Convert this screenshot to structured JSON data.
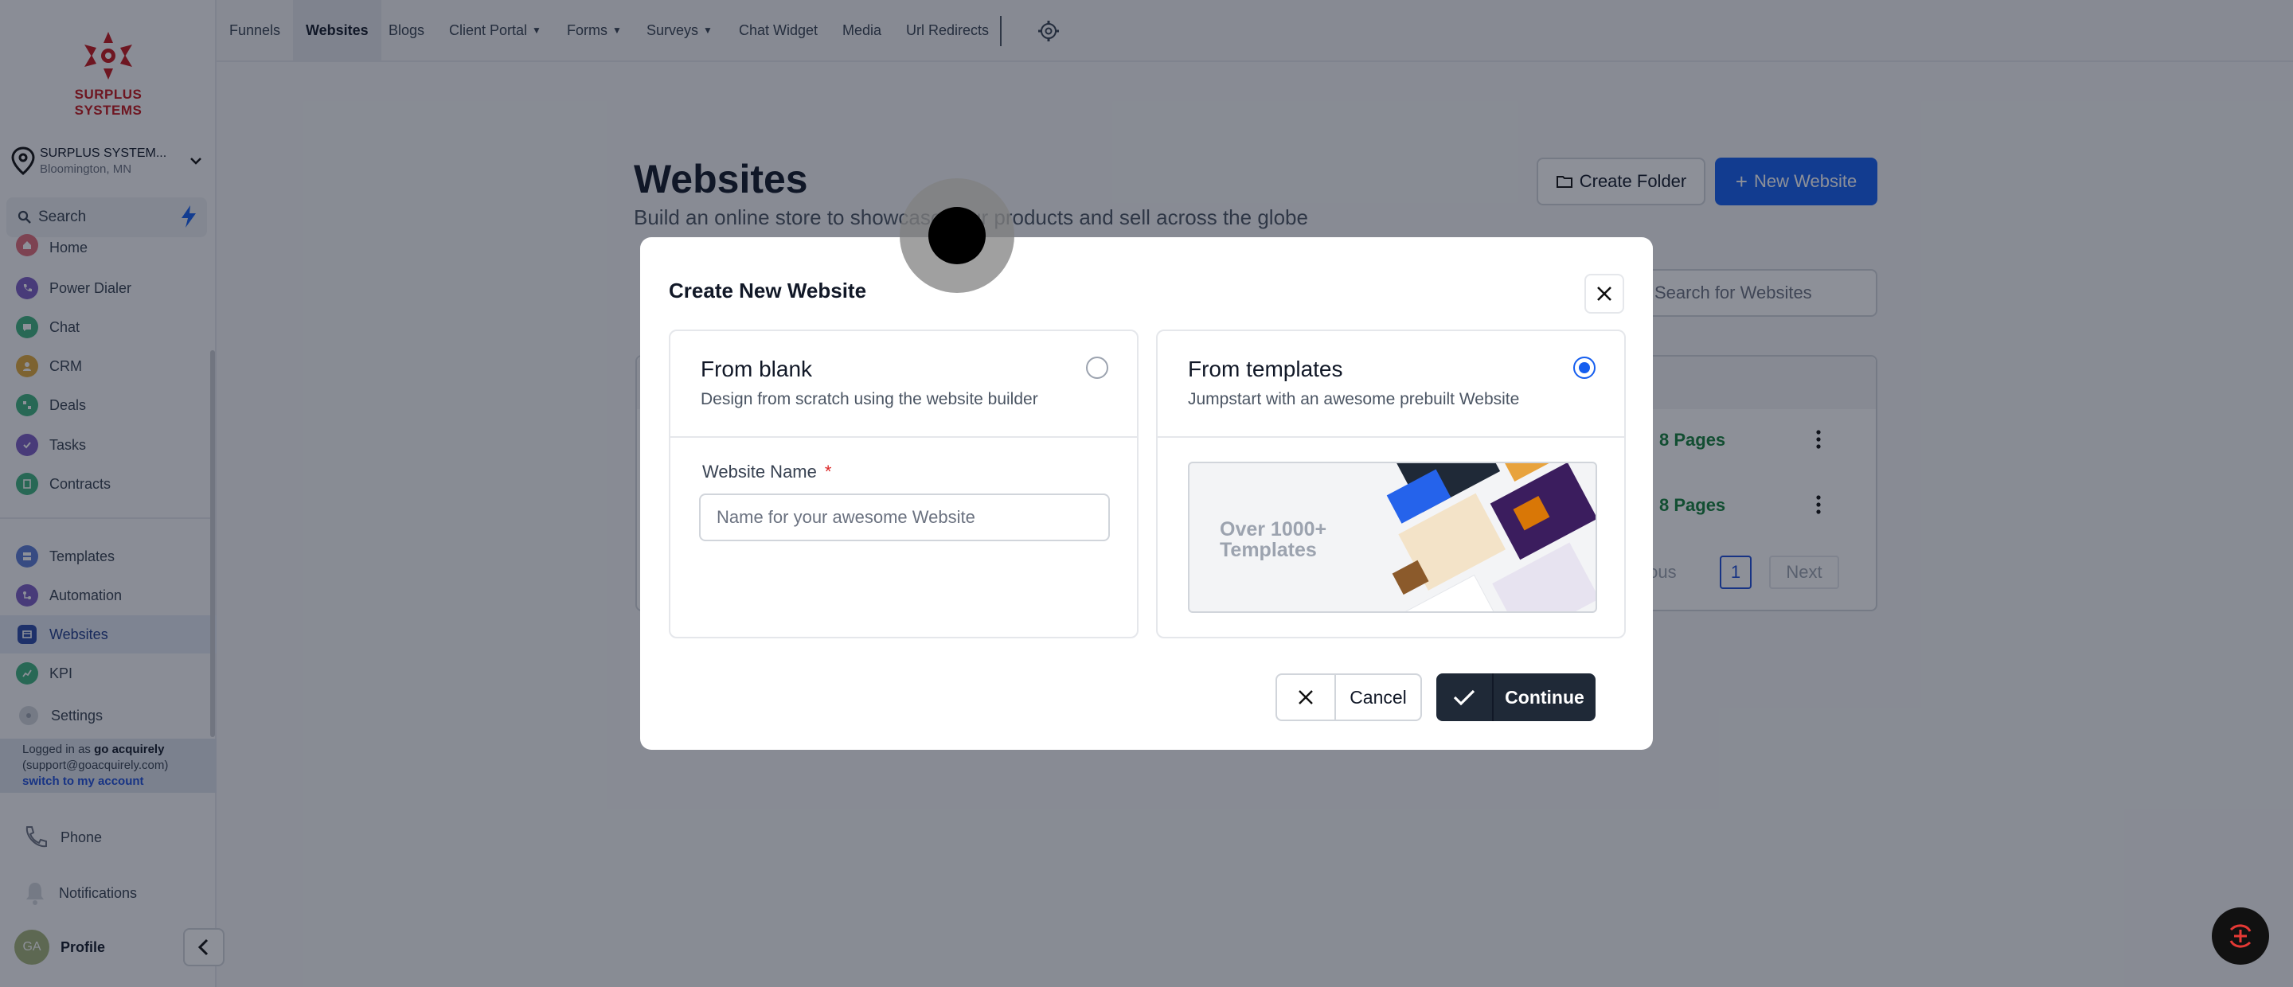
{
  "brand": {
    "name": "SURPLUS SYSTEMS"
  },
  "location": {
    "name": "SURPLUS SYSTEM...",
    "city": "Bloomington, MN"
  },
  "search": {
    "placeholder": "Search"
  },
  "sidebar": {
    "items": [
      {
        "label": "Home",
        "icon": "home-icon",
        "color": "#e06b7a"
      },
      {
        "label": "Power Dialer",
        "icon": "phone-dialer-icon",
        "color": "#7c5cc4"
      },
      {
        "label": "Chat",
        "icon": "chat-icon",
        "color": "#3fb27f"
      },
      {
        "label": "CRM",
        "icon": "crm-icon",
        "color": "#e0a93b"
      },
      {
        "label": "Deals",
        "icon": "deals-icon",
        "color": "#3fb27f"
      },
      {
        "label": "Tasks",
        "icon": "tasks-icon",
        "color": "#7c5cc4"
      },
      {
        "label": "Contracts",
        "icon": "contracts-icon",
        "color": "#3fb27f"
      },
      {
        "label": "Templates",
        "icon": "templates-icon",
        "color": "#5b7bd5"
      },
      {
        "label": "Automation",
        "icon": "automation-icon",
        "color": "#7c5cc4"
      },
      {
        "label": "Websites",
        "icon": "websites-icon",
        "color": "#2b4aa8"
      },
      {
        "label": "KPI",
        "icon": "kpi-icon",
        "color": "#3fb27f"
      },
      {
        "label": "Settings",
        "icon": "settings-icon",
        "color": "#9ca3af"
      }
    ]
  },
  "login": {
    "prefix": "Logged in as ",
    "user": "go acquirely",
    "email": "(support@goacquirely.com)",
    "switch": "switch to my account"
  },
  "bottom": {
    "phone": "Phone",
    "notifications": "Notifications",
    "profile": "Profile",
    "initials": "GA"
  },
  "topbar": {
    "tabs": [
      {
        "label": "Funnels"
      },
      {
        "label": "Websites"
      },
      {
        "label": "Blogs"
      },
      {
        "label": "Client Portal"
      },
      {
        "label": "Forms"
      },
      {
        "label": "Surveys"
      },
      {
        "label": "Chat Widget"
      },
      {
        "label": "Media"
      },
      {
        "label": "Url Redirects"
      }
    ]
  },
  "page": {
    "title": "Websites",
    "subtitle": "Build an online store to showcase your products and sell across the globe",
    "create_folder": "Create Folder",
    "new_website": "New Website",
    "search_placeholder": "Search for Websites",
    "rows": [
      {
        "pages": "8 Pages"
      },
      {
        "pages": "8 Pages"
      }
    ],
    "pagination": {
      "previous": "Previous",
      "current": "1",
      "next": "Next"
    }
  },
  "modal": {
    "title": "Create New Website",
    "blank": {
      "title": "From blank",
      "desc": "Design from scratch using the website builder",
      "selected": false
    },
    "templates": {
      "title": "From templates",
      "desc": "Jumpstart with an awesome prebuilt Website",
      "selected": true,
      "image_text": "Over 1000+ Templates"
    },
    "field": {
      "label": "Website Name",
      "required": "*",
      "placeholder": "Name for your awesome Website",
      "value": ""
    },
    "cancel": "Cancel",
    "continue": "Continue"
  }
}
